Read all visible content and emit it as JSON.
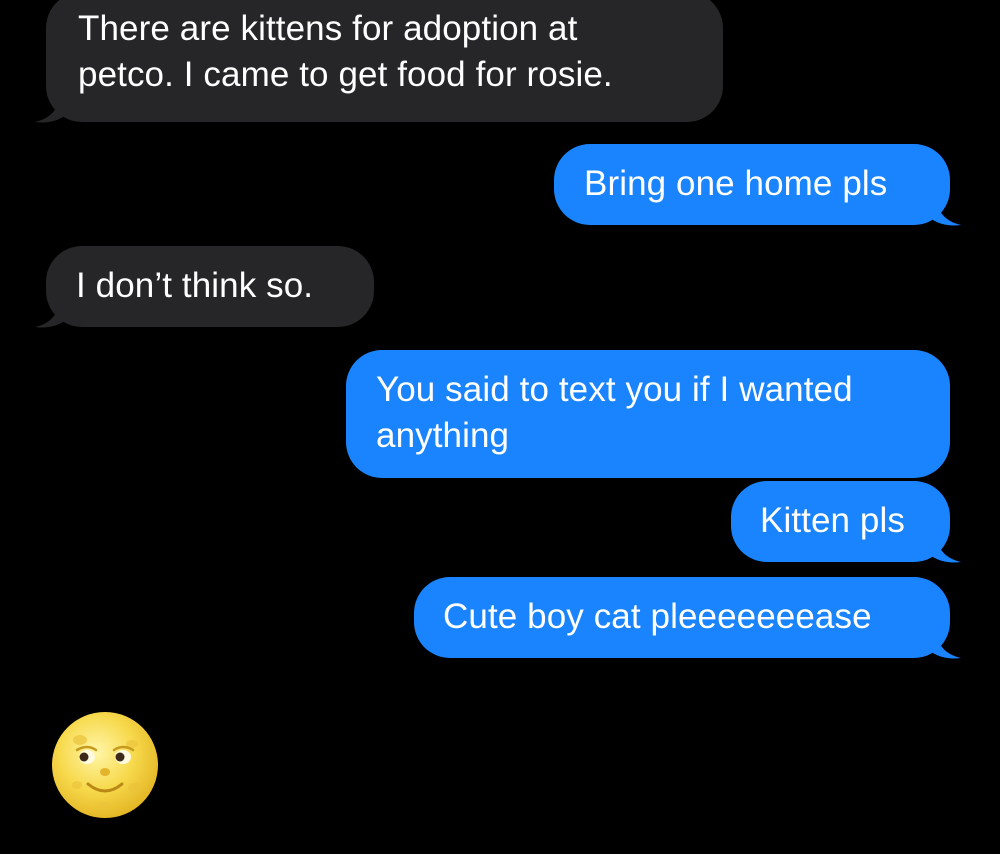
{
  "colors": {
    "background": "#000000",
    "incoming_bubble": "#262628",
    "outgoing_bubble": "#1a84ff",
    "text": "#ffffff"
  },
  "messages": [
    {
      "direction": "incoming",
      "lines": [
        "There are kittens for adoption at",
        "petco. I came to get food for rosie."
      ]
    },
    {
      "direction": "outgoing",
      "lines": [
        "Bring one home pls"
      ]
    },
    {
      "direction": "incoming",
      "lines": [
        "I don’t think so."
      ]
    },
    {
      "direction": "outgoing",
      "lines": [
        "You said to text you if I wanted",
        "anything"
      ]
    },
    {
      "direction": "outgoing",
      "lines": [
        "Kitten pls"
      ]
    },
    {
      "direction": "outgoing",
      "lines": [
        "Cute boy cat pleeeeeeease"
      ]
    }
  ],
  "emoji_message": {
    "direction": "incoming",
    "icon": "full-moon-face-icon"
  }
}
